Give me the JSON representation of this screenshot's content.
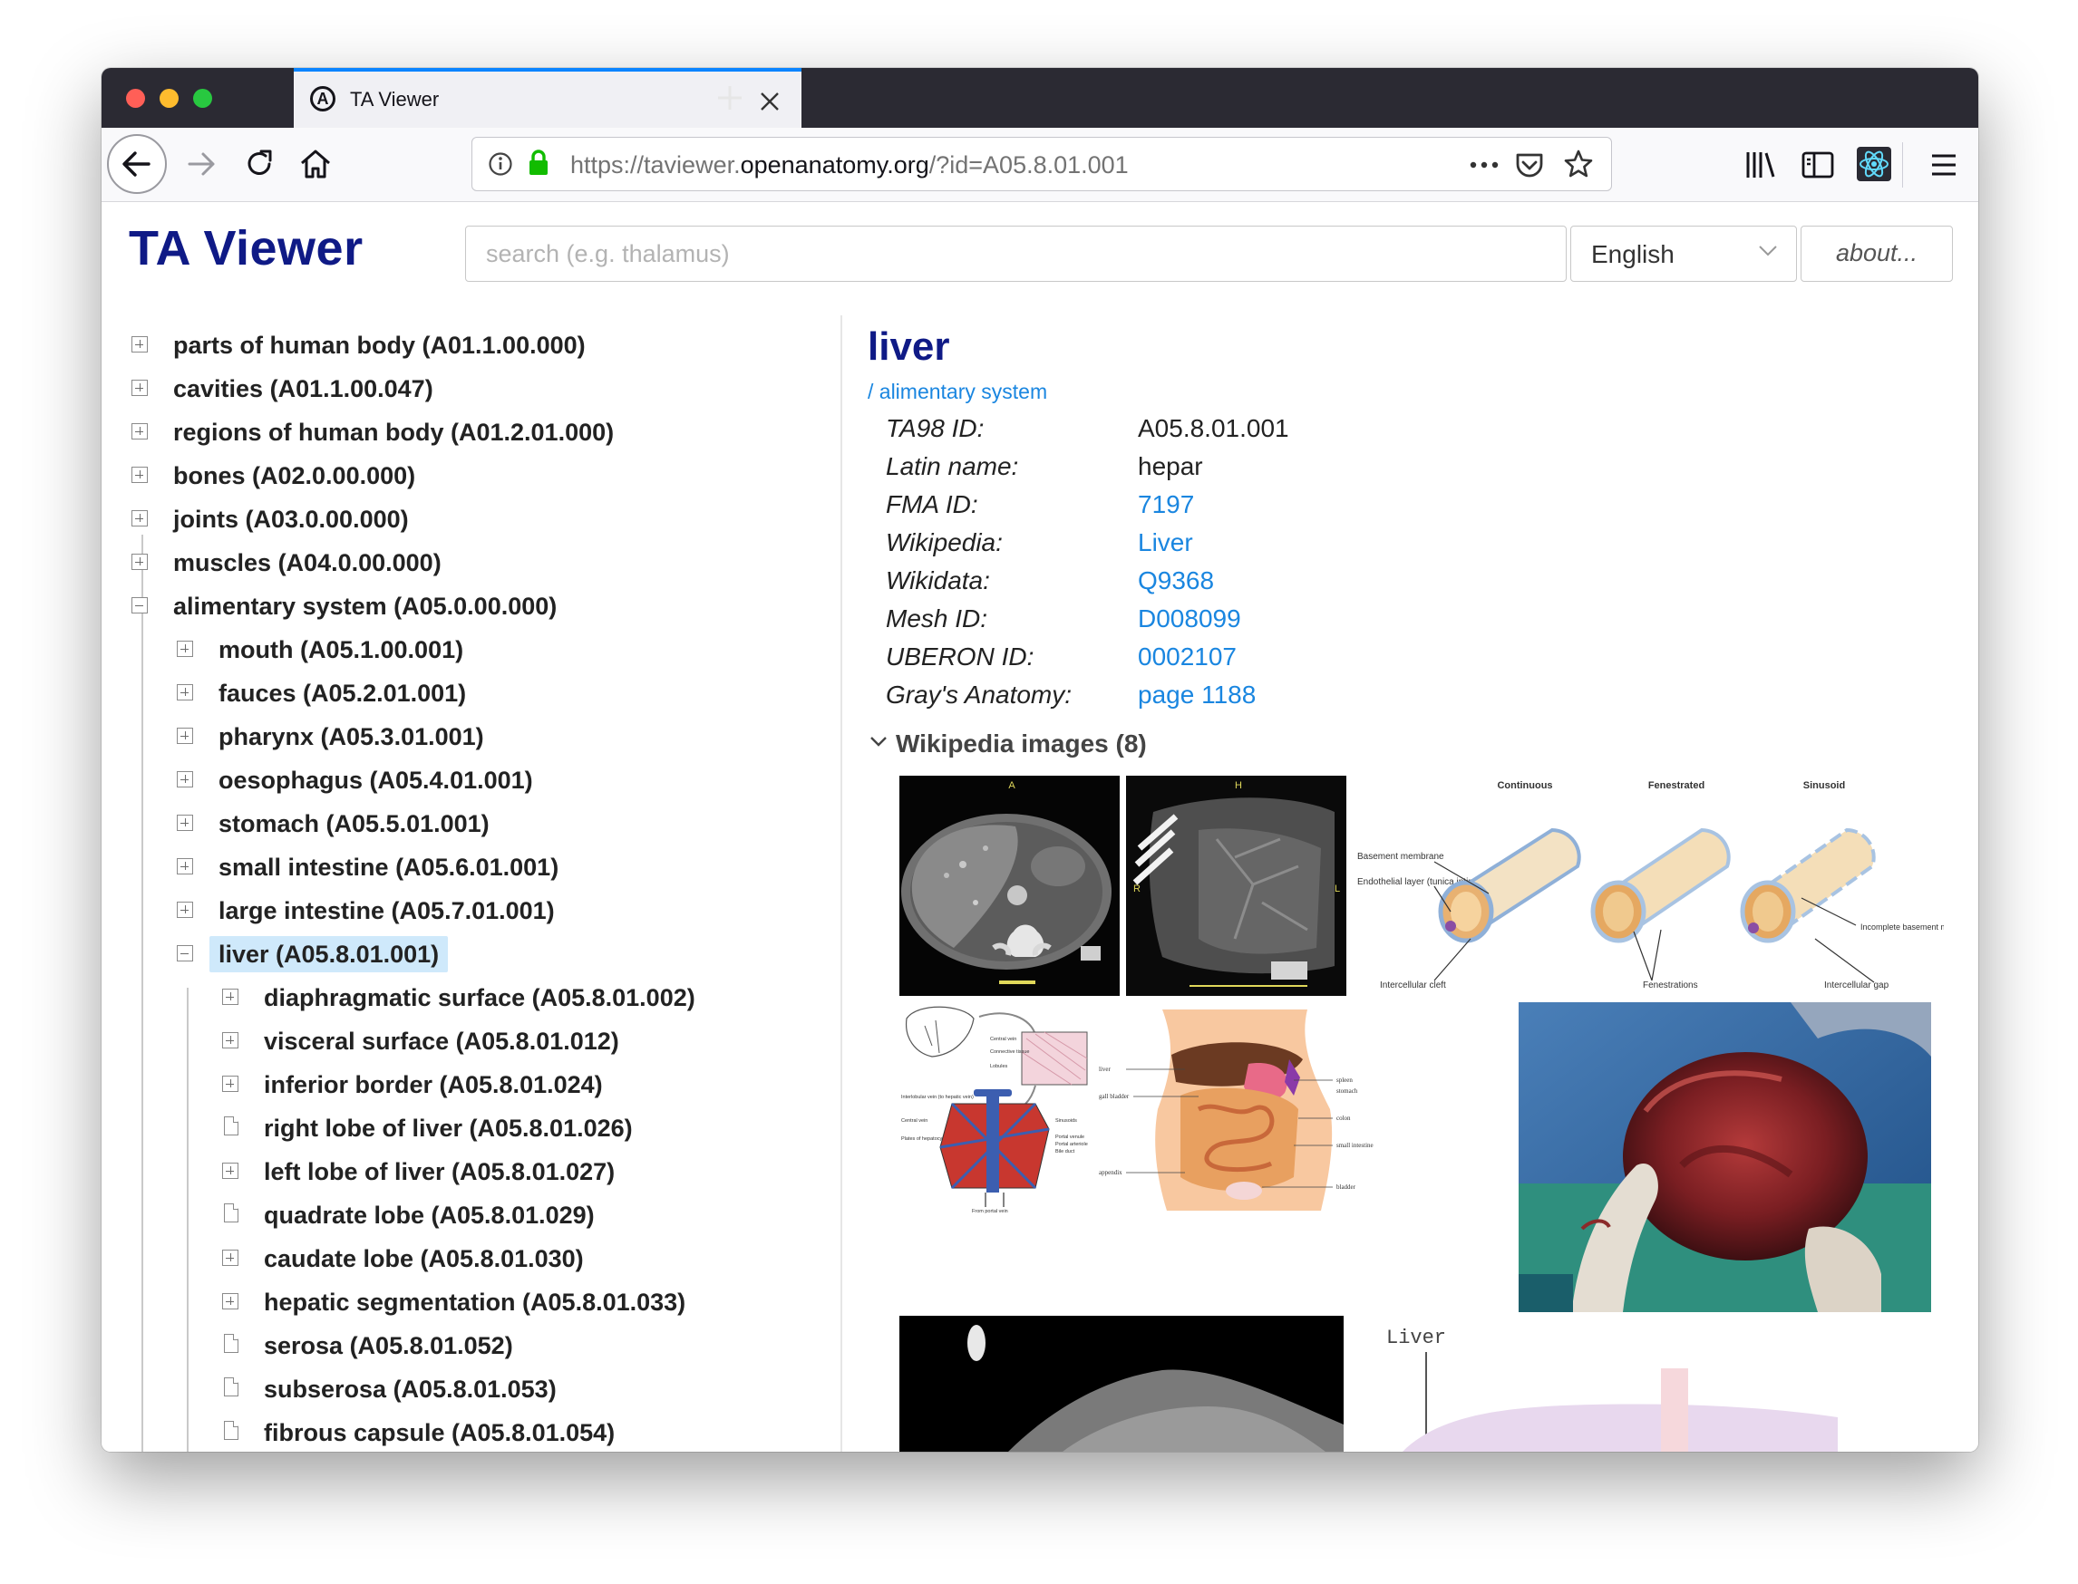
{
  "browser": {
    "tab_title": "TA Viewer",
    "tab_close_icon": "close-icon",
    "new_tab_glyph": "+",
    "url_scheme_prefix": "https://taviewer.",
    "url_host": "openanatomy.org",
    "url_path": "/?id=A05.8.01.001",
    "accent_color": "#0a84ff"
  },
  "header": {
    "site_title": "TA Viewer",
    "search_placeholder": "search (e.g. thalamus)",
    "language": "English",
    "about_label": "about..."
  },
  "tree": [
    {
      "label": "parts of human body (A01.1.00.000)",
      "icon": "expand-icon"
    },
    {
      "label": "cavities (A01.1.00.047)",
      "icon": "expand-icon"
    },
    {
      "label": "regions of human body (A01.2.01.000)",
      "icon": "expand-icon"
    },
    {
      "label": "bones (A02.0.00.000)",
      "icon": "expand-icon"
    },
    {
      "label": "joints (A03.0.00.000)",
      "icon": "expand-icon"
    },
    {
      "label": "muscles (A04.0.00.000)",
      "icon": "expand-icon"
    },
    {
      "label": "alimentary system (A05.0.00.000)",
      "icon": "collapse-icon"
    },
    {
      "label": "mouth (A05.1.00.001)",
      "icon": "expand-icon"
    },
    {
      "label": "fauces (A05.2.01.001)",
      "icon": "expand-icon"
    },
    {
      "label": "pharynx (A05.3.01.001)",
      "icon": "expand-icon"
    },
    {
      "label": "oesophagus (A05.4.01.001)",
      "icon": "expand-icon"
    },
    {
      "label": "stomach (A05.5.01.001)",
      "icon": "expand-icon"
    },
    {
      "label": "small intestine (A05.6.01.001)",
      "icon": "expand-icon"
    },
    {
      "label": "large intestine (A05.7.01.001)",
      "icon": "expand-icon"
    },
    {
      "label": "liver (A05.8.01.001)",
      "icon": "collapse-icon",
      "selected": true
    },
    {
      "label": "diaphragmatic surface (A05.8.01.002)",
      "icon": "expand-icon"
    },
    {
      "label": "visceral surface (A05.8.01.012)",
      "icon": "expand-icon"
    },
    {
      "label": "inferior border (A05.8.01.024)",
      "icon": "expand-icon"
    },
    {
      "label": "right lobe of liver (A05.8.01.026)",
      "icon": "document-icon"
    },
    {
      "label": "left lobe of liver (A05.8.01.027)",
      "icon": "expand-icon"
    },
    {
      "label": "quadrate lobe (A05.8.01.029)",
      "icon": "document-icon"
    },
    {
      "label": "caudate lobe (A05.8.01.030)",
      "icon": "expand-icon"
    },
    {
      "label": "hepatic segmentation (A05.8.01.033)",
      "icon": "expand-icon"
    },
    {
      "label": "serosa (A05.8.01.052)",
      "icon": "document-icon"
    },
    {
      "label": "subserosa (A05.8.01.053)",
      "icon": "document-icon"
    },
    {
      "label": "fibrous capsule (A05.8.01.054)",
      "icon": "document-icon"
    }
  ],
  "detail": {
    "title": "liver",
    "breadcrumb": "/ alimentary system",
    "properties": [
      {
        "key": "TA98 ID:",
        "value": "A05.8.01.001",
        "link": false
      },
      {
        "key": "Latin name:",
        "value": "hepar",
        "link": false
      },
      {
        "key": "FMA ID:",
        "value": "7197",
        "link": true
      },
      {
        "key": "Wikipedia:",
        "value": "Liver",
        "link": true
      },
      {
        "key": "Wikidata:",
        "value": "Q9368",
        "link": true
      },
      {
        "key": "Mesh ID:",
        "value": "D008099",
        "link": true
      },
      {
        "key": "UBERON ID:",
        "value": "0002107",
        "link": true
      },
      {
        "key": "Gray's Anatomy:",
        "value": "page 1188",
        "link": true
      }
    ],
    "wiki_images_label": "Wikipedia images (8)",
    "images": {
      "ct_axial": {
        "label_top": "A"
      },
      "ct_coronal": {
        "label_top": "H",
        "label_left": "R",
        "label_right": "L"
      },
      "capillaries": {
        "headings": [
          "Continuous",
          "Fenestrated",
          "Sinusoid"
        ],
        "labels": [
          "Basement membrane",
          "Endothelial layer (tunica intima)",
          "Intercellular cleft",
          "Fenestrations",
          "Incomplete basement membrane",
          "Intercellular gap"
        ]
      },
      "lobule": {
        "labels": [
          "Central vein",
          "Connective tissue",
          "Lobules",
          "Interlobular vein (to hepatic vein)",
          "Central vein",
          "Sinusoids",
          "Plates of hepatocytes",
          "Portal venule",
          "Portal arteriole",
          "Bile duct",
          "From portal vein"
        ]
      },
      "abdomen": {
        "labels": [
          "liver",
          "gall bladder",
          "appendix",
          "spleen",
          "stomach",
          "colon",
          "small intestine",
          "bladder"
        ]
      },
      "diagram_label": "Liver"
    }
  }
}
